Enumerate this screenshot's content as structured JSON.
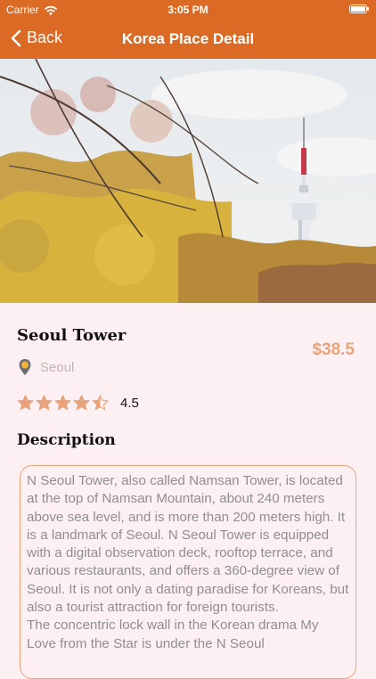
{
  "status": {
    "carrier": "Carrier",
    "time": "3:05 PM"
  },
  "nav": {
    "back_label": "Back",
    "title": "Korea Place Detail"
  },
  "place": {
    "name": "Seoul Tower",
    "price": "$38.5",
    "location": "Seoul",
    "rating": 4.5,
    "rating_text": "4.5",
    "stars_total": 5
  },
  "description": {
    "heading": "Description",
    "text": "N Seoul Tower, also called Namsan Tower, is located at the top of Namsan Mountain, about 240 meters above sea level, and is more than 200 meters high. It is a landmark of Seoul. N Seoul Tower is equipped with a digital observation deck, rooftop terrace, and various restaurants, and offers a 360-degree view of Seoul. It is not only a dating paradise for Koreans, but also a tourist attraction for foreign tourists.\nThe concentric lock wall in the Korean drama My Love from the Star is under the N Seoul"
  },
  "colors": {
    "accent": "#da6a24",
    "price": "#e8a37a",
    "star": "#e8a37a",
    "background": "#fdf0f3"
  },
  "icons": {
    "back": "chevron-left-icon",
    "location": "location-pin-icon",
    "star": "star-icon",
    "wifi": "wifi-icon",
    "battery": "battery-icon"
  }
}
